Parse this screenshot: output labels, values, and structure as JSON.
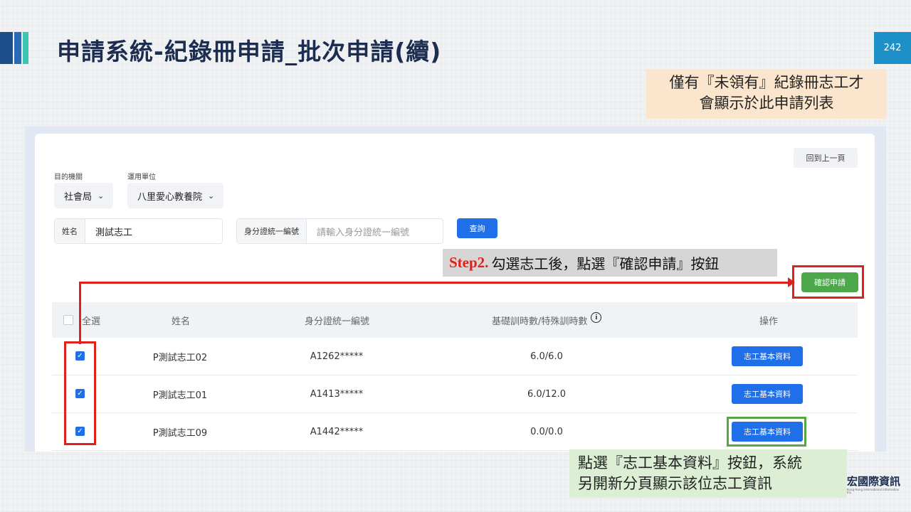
{
  "slide": {
    "title": "申請系統-紀錄冊申請_批次申請(續)",
    "page_number": "242",
    "note_top": "僅有『未領有』紀錄冊志工才\n會顯示於此申請列表",
    "step_label": "Step2.",
    "step_text": "勾選志工後，點選『確認申請』按鈕",
    "note_bottom": "點選『志工基本資料』按鈕，系統\n另開新分頁顯示該位志工資訊",
    "logo_text": "宏國際資訊",
    "logo_sub": "Kung-Hung International Information Inc."
  },
  "colors": {
    "primary_blue": "#1e6fe8",
    "confirm_green": "#4ca84a",
    "annotation_red": "#e0201b",
    "annotation_green": "#5aa545",
    "title_navy": "#1d2d50"
  },
  "form": {
    "back_button": "回到上一頁",
    "agency_label": "目的機關",
    "agency_value": "社會局",
    "unit_label": "運用單位",
    "unit_value": "八里愛心教養院",
    "name_label": "姓名",
    "name_value": "測試志工",
    "id_label": "身分證統一編號",
    "id_placeholder": "請輸入身分證統一編號",
    "query_button": "查詢",
    "confirm_button": "確認申請"
  },
  "table": {
    "headers": {
      "select_all": "全選",
      "name": "姓名",
      "id": "身分證統一編號",
      "hours": "基礎訓時數/特殊訓時數",
      "action": "操作"
    },
    "rows": [
      {
        "checked": true,
        "name": "P測試志工02",
        "id": "A1262*****",
        "hours": "6.0/6.0",
        "action": "志工基本資料"
      },
      {
        "checked": true,
        "name": "P測試志工01",
        "id": "A1413*****",
        "hours": "6.0/12.0",
        "action": "志工基本資料"
      },
      {
        "checked": true,
        "name": "P測試志工09",
        "id": "A1442*****",
        "hours": "0.0/0.0",
        "action": "志工基本資料"
      }
    ]
  }
}
